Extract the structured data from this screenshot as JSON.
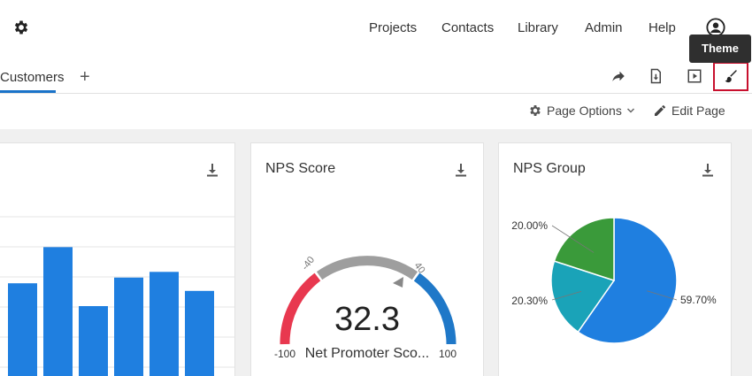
{
  "nav": {
    "links": [
      "Projects",
      "Contacts",
      "Library",
      "Admin",
      "Help"
    ]
  },
  "tooltip": {
    "label": "Theme"
  },
  "tabs": {
    "active_label": "Customers",
    "add_label": "+"
  },
  "toolbar": {
    "page_options_label": "Page Options",
    "edit_page_label": "Edit Page"
  },
  "bar_widget": {
    "chart_data": {
      "type": "bar",
      "values": [
        0.52,
        0.71,
        0.4,
        0.55,
        0.58,
        0.48
      ],
      "note": "partially cropped; values are fractions of the visible plot height"
    }
  },
  "nps_widget": {
    "title": "NPS Score",
    "value": "32.3",
    "label": "Net Promoter Sco...",
    "scale_min": "-100",
    "scale_max": "100",
    "tick_low": "-40",
    "tick_high": "40",
    "colors": {
      "detractor": "#e8384f",
      "passive": "#9e9e9e",
      "promoter": "#1f78c8"
    }
  },
  "group_widget": {
    "title": "NPS Group",
    "chart_data": {
      "type": "pie",
      "slices": [
        {
          "label": "59.70%",
          "value": 59.7,
          "color": "#1f7fe0"
        },
        {
          "label": "20.30%",
          "value": 20.3,
          "color": "#1aa3b8"
        },
        {
          "label": "20.00%",
          "value": 20.0,
          "color": "#3a9a3a"
        }
      ]
    }
  }
}
